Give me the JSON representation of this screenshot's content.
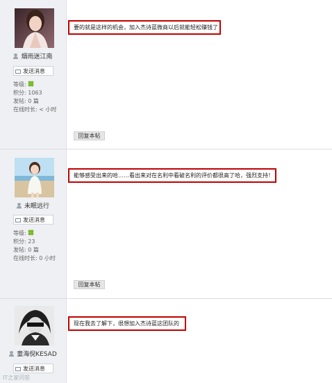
{
  "posts": [
    {
      "username": "烟雨迷江南",
      "send_message": "发送消息",
      "level_label": "等级:",
      "points_label": "积分:",
      "points_value": "1063",
      "posts_label": "发帖:",
      "posts_value": "0 篇",
      "online_label": "在线时长:",
      "online_value": "< 小时",
      "content": "要的就是这样的机会，加入杰诗蓝微商以后就能轻松赚钱了",
      "reply_label": "回复本帖"
    },
    {
      "username": "未眠远行",
      "send_message": "发送消息",
      "level_label": "等级:",
      "points_label": "积分:",
      "points_value": "23",
      "posts_label": "发帖:",
      "posts_value": "0 篇",
      "online_label": "在线时长:",
      "online_value": "0 小时",
      "content": "能够感受出来的哈……看出来对在名利中看破名利的评价都很高了哈，强烈支持！",
      "reply_label": "回复本帖"
    },
    {
      "username": "童海倪KESAD",
      "send_message": "发送消息",
      "content": "现在我去了解下，很想加入杰诗蓝这团队的"
    }
  ],
  "watermark": "IT之家问答",
  "colors": {
    "highlight_border": "#c00000",
    "sidebar_bg": "#eef0f3",
    "level_icon": "#7ab82e"
  }
}
